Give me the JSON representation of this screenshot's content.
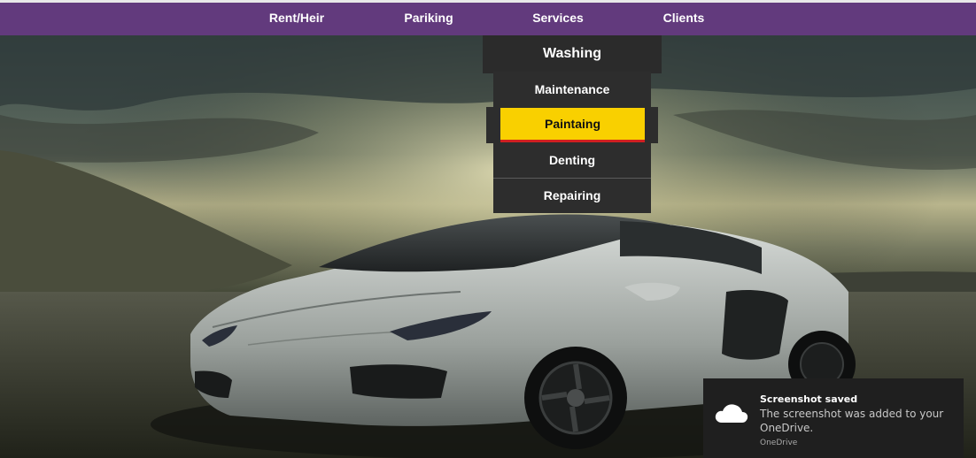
{
  "nav": {
    "items": [
      {
        "label": "Rent/Heir"
      },
      {
        "label": "Pariking"
      },
      {
        "label": "Services"
      },
      {
        "label": "Clients"
      }
    ]
  },
  "services_menu": {
    "items": [
      {
        "label": "Washing"
      },
      {
        "label": "Maintenance"
      },
      {
        "label": "Paintaing",
        "active": true
      },
      {
        "label": "Denting"
      },
      {
        "label": "Repairing"
      }
    ]
  },
  "toast": {
    "title": "Screenshot saved",
    "body": "The screenshot was added to your OneDrive.",
    "source": "OneDrive",
    "icon": "onedrive-cloud-icon"
  },
  "colors": {
    "nav_bg": "#623a7d",
    "menu_bg": "#2d2d2d",
    "active_bg": "#f9d000",
    "active_underline": "#d02020"
  }
}
